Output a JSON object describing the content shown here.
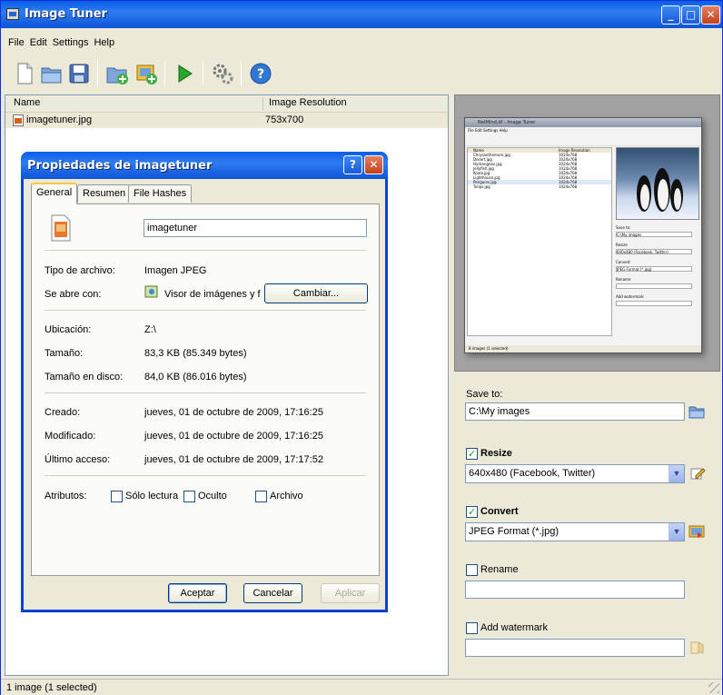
{
  "window": {
    "title": "Image Tuner"
  },
  "menu": [
    "File",
    "Edit",
    "Settings",
    "Help"
  ],
  "toolbar": {
    "icons": [
      "new-icon",
      "open-folder-icon",
      "save-icon",
      "add-folder-icon",
      "add-image-icon",
      "run-icon",
      "settings-gear-icon",
      "help-icon"
    ]
  },
  "list": {
    "columns": [
      "Name",
      "Image Resolution"
    ],
    "rows": [
      {
        "name": "imagetuner.jpg",
        "resolution": "753x700"
      }
    ]
  },
  "preview": {
    "mini_title": "NetMind.df - Image Tuner",
    "mini_menu": "File  Edit  Settings  Help",
    "mini_rows": [
      "Chrysanthemum.jpg",
      "Desert.jpg",
      "Hydrangeas.jpg",
      "Jellyfish.jpg",
      "Koala.jpg",
      "Lighthouse.jpg",
      "Penguins.jpg",
      "Tulips.jpg"
    ],
    "mini_res": "1024x768",
    "mini_status": "8 images (1 selected)",
    "mini_side": [
      "Save to:",
      "C:\\My images",
      "Resize",
      "640x480 (Facebook, Twitter)",
      "Convert",
      "JPEG Format (*.jpg)",
      "Rename",
      "Add watermark"
    ]
  },
  "side": {
    "save_to_label": "Save to:",
    "save_to_value": "C:\\My images",
    "resize_label": "Resize",
    "resize_value": "640x480 (Facebook, Twitter)",
    "convert_label": "Convert",
    "convert_value": "JPEG Format (*.jpg)",
    "rename_label": "Rename",
    "rename_value": "",
    "watermark_label": "Add watermark",
    "watermark_value": "",
    "resize_checked": true,
    "convert_checked": true,
    "rename_checked": false,
    "watermark_checked": false
  },
  "status": {
    "text": "1 image (1 selected)"
  },
  "dialog": {
    "title": "Propiedades de imagetuner",
    "tabs": [
      "General",
      "Resumen",
      "File Hashes"
    ],
    "active_tab": "General",
    "filename": "imagetuner",
    "type_label": "Tipo de archivo:",
    "type_value": "Imagen JPEG",
    "opens_label": "Se abre con:",
    "opens_value": "Visor de imágenes y f",
    "change_button": "Cambiar...",
    "location_label": "Ubicación:",
    "location_value": "Z:\\",
    "size_label": "Tamaño:",
    "size_value": "83,3 KB (85.349 bytes)",
    "disk_label": "Tamaño en disco:",
    "disk_value": "84,0 KB (86.016 bytes)",
    "created_label": "Creado:",
    "created_value": "jueves, 01 de octubre de 2009, 17:16:25",
    "modified_label": "Modificado:",
    "modified_value": "jueves, 01 de octubre de 2009, 17:16:25",
    "accessed_label": "Último acceso:",
    "accessed_value": "jueves, 01 de octubre de 2009, 17:17:52",
    "attributes_label": "Atributos:",
    "attr_readonly": "Sólo lectura",
    "attr_hidden": "Oculto",
    "attr_archive": "Archivo",
    "ok_button": "Aceptar",
    "cancel_button": "Cancelar",
    "apply_button": "Aplicar"
  }
}
